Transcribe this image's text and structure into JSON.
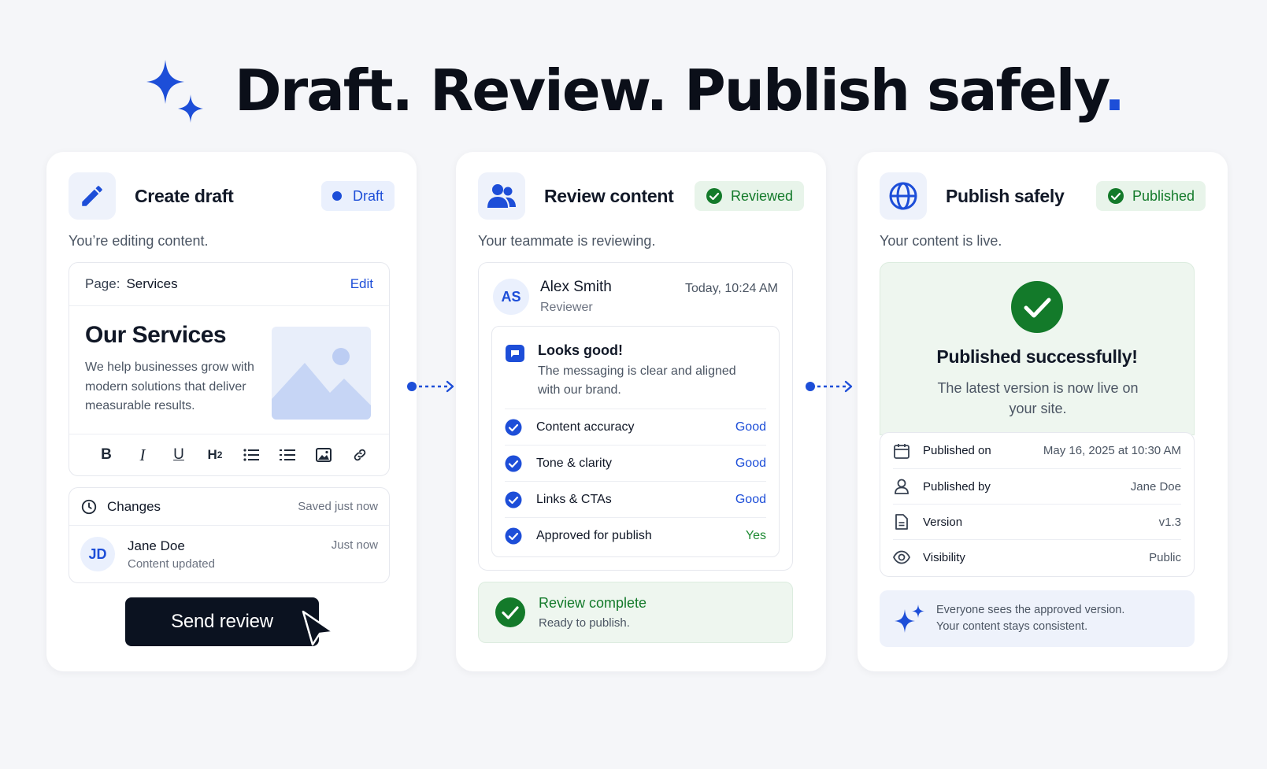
{
  "headline": {
    "text": "Draft. Review. Publish safely",
    "dot": "."
  },
  "colors": {
    "accent": "#1d4ed8",
    "success": "#137a2a",
    "dark_button": "#0b1220",
    "background": "#f5f6f9"
  },
  "draft_card": {
    "title": "Create draft",
    "badge": "Draft",
    "subtitle": "You’re editing content.",
    "editor": {
      "page_label": "Page:",
      "page_value": "Services",
      "edit_label": "Edit",
      "heading": "Our Services",
      "body": "We help businesses grow with modern solutions that deliver measurable results.",
      "toolbar": [
        "bold-icon",
        "italic-icon",
        "underline-icon",
        "heading-2-icon",
        "bulleted-list-icon",
        "list-icon",
        "image-icon",
        "link-icon"
      ],
      "toolbar_labels": {
        "bold": "B",
        "italic": "I",
        "underline": "U",
        "heading": "H",
        "heading_sub": "2"
      }
    },
    "changes": {
      "label": "Changes",
      "status": "Saved just now",
      "entry": {
        "initials": "JD",
        "name": "Jane Doe",
        "action": "Content updated",
        "time": "Just now"
      }
    },
    "button": "Send review"
  },
  "review_card": {
    "title": "Review content",
    "badge": "Reviewed",
    "subtitle": "Your teammate is reviewing.",
    "reviewer": {
      "initials": "AS",
      "name": "Alex Smith",
      "role": "Reviewer",
      "time": "Today, 10:24 AM"
    },
    "comment": {
      "title": "Looks good!",
      "body": "The messaging is clear and aligned with our brand."
    },
    "checks": [
      {
        "label": "Content accuracy",
        "value": "Good"
      },
      {
        "label": "Tone & clarity",
        "value": "Good"
      },
      {
        "label": "Links & CTAs",
        "value": "Good"
      },
      {
        "label": "Approved for publish",
        "value": "Yes"
      }
    ],
    "complete": {
      "title": "Review complete",
      "body": "Ready to publish."
    }
  },
  "publish_card": {
    "title": "Publish safely",
    "badge": "Published",
    "subtitle": "Your content is live.",
    "success": {
      "title": "Published successfully!",
      "body": "The latest version is now live on your site."
    },
    "details": [
      {
        "icon": "calendar-icon",
        "label": "Published on",
        "value": "May 16, 2025 at 10:30 AM"
      },
      {
        "icon": "user-icon",
        "label": "Published by",
        "value": "Jane Doe"
      },
      {
        "icon": "document-icon",
        "label": "Version",
        "value": "v1.3"
      },
      {
        "icon": "eye-icon",
        "label": "Visibility",
        "value": "Public"
      }
    ],
    "note": {
      "line1": "Everyone sees the approved version.",
      "line2": "Your content stays consistent."
    }
  }
}
